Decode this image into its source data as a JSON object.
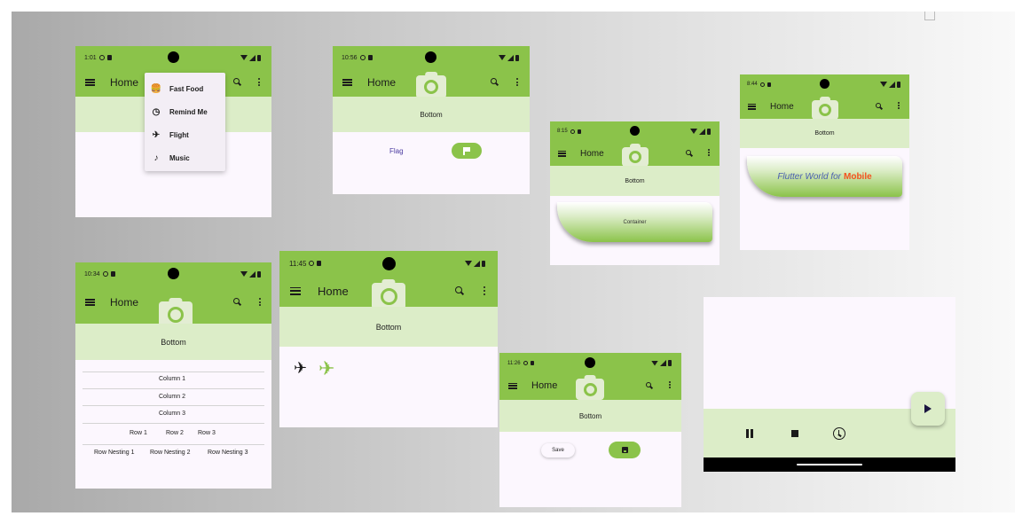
{
  "colors": {
    "appbar": "#8bc34a",
    "bottom_bar": "#dcedc8",
    "surface": "#fcf7fe",
    "accent_text": "#4a3aa0",
    "mobile_text": "#f4511e"
  },
  "phone1": {
    "time": "1:01",
    "title": "Home",
    "menu": [
      {
        "label": "Fast Food",
        "icon": "fastfood-icon"
      },
      {
        "label": "Remind Me",
        "icon": "alarm-icon"
      },
      {
        "label": "Flight",
        "icon": "flight-icon"
      },
      {
        "label": "Music",
        "icon": "music-note-icon"
      }
    ]
  },
  "phone2": {
    "time": "10:56",
    "title": "Home",
    "bottom": "Bottom",
    "flag_label": "Flag"
  },
  "phone3": {
    "time": "8:15",
    "title": "Home",
    "bottom": "Bottom",
    "container_label": "Container"
  },
  "phone4": {
    "time": "8:44",
    "title": "Home",
    "bottom": "Bottom",
    "flutter_text": "Flutter World for",
    "mobile_text": "Mobile"
  },
  "phone5": {
    "time": "10:34",
    "title": "Home",
    "bottom": "Bottom",
    "columns": [
      "Column 1",
      "Column 2",
      "Column 3"
    ],
    "rows": [
      "Row 1",
      "Row 2",
      "Row 3"
    ],
    "row_nesting": [
      "Row Nesting 1",
      "Row Nesting  2",
      "Row Nesting 3"
    ]
  },
  "phone6": {
    "time": "11:45",
    "title": "Home",
    "bottom": "Bottom"
  },
  "phone7": {
    "time": "11:26",
    "title": "Home",
    "bottom": "Bottom",
    "save_label": "Save"
  },
  "player": {
    "play": "play-icon",
    "pause": "pause-icon",
    "stop": "stop-icon",
    "timer": "clock-icon"
  }
}
